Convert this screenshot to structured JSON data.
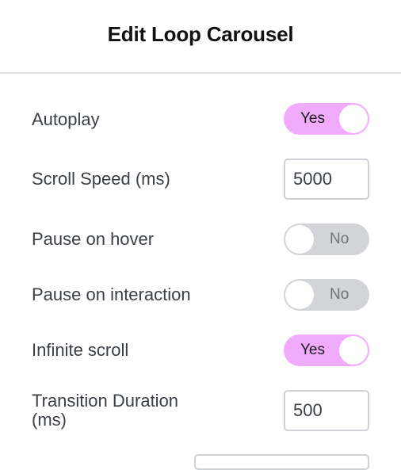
{
  "header": {
    "title": "Edit Loop Carousel"
  },
  "settings": {
    "autoplay": {
      "label": "Autoplay",
      "value": "Yes",
      "on": true
    },
    "scroll_speed": {
      "label": "Scroll Speed (ms)",
      "value": "5000"
    },
    "pause_on_hover": {
      "label": "Pause on hover",
      "value": "No",
      "on": false
    },
    "pause_on_interaction": {
      "label": "Pause on interaction",
      "value": "No",
      "on": false
    },
    "infinite_scroll": {
      "label": "Infinite scroll",
      "value": "Yes",
      "on": true
    },
    "transition_duration": {
      "label_line1": "Transition Duration",
      "label_line2": "(ms)",
      "value": "500"
    }
  },
  "colors": {
    "toggle_on": "#f0abfc",
    "toggle_off": "#d2d4d8",
    "text": "#3a3f45",
    "border": "#ced1d5"
  }
}
